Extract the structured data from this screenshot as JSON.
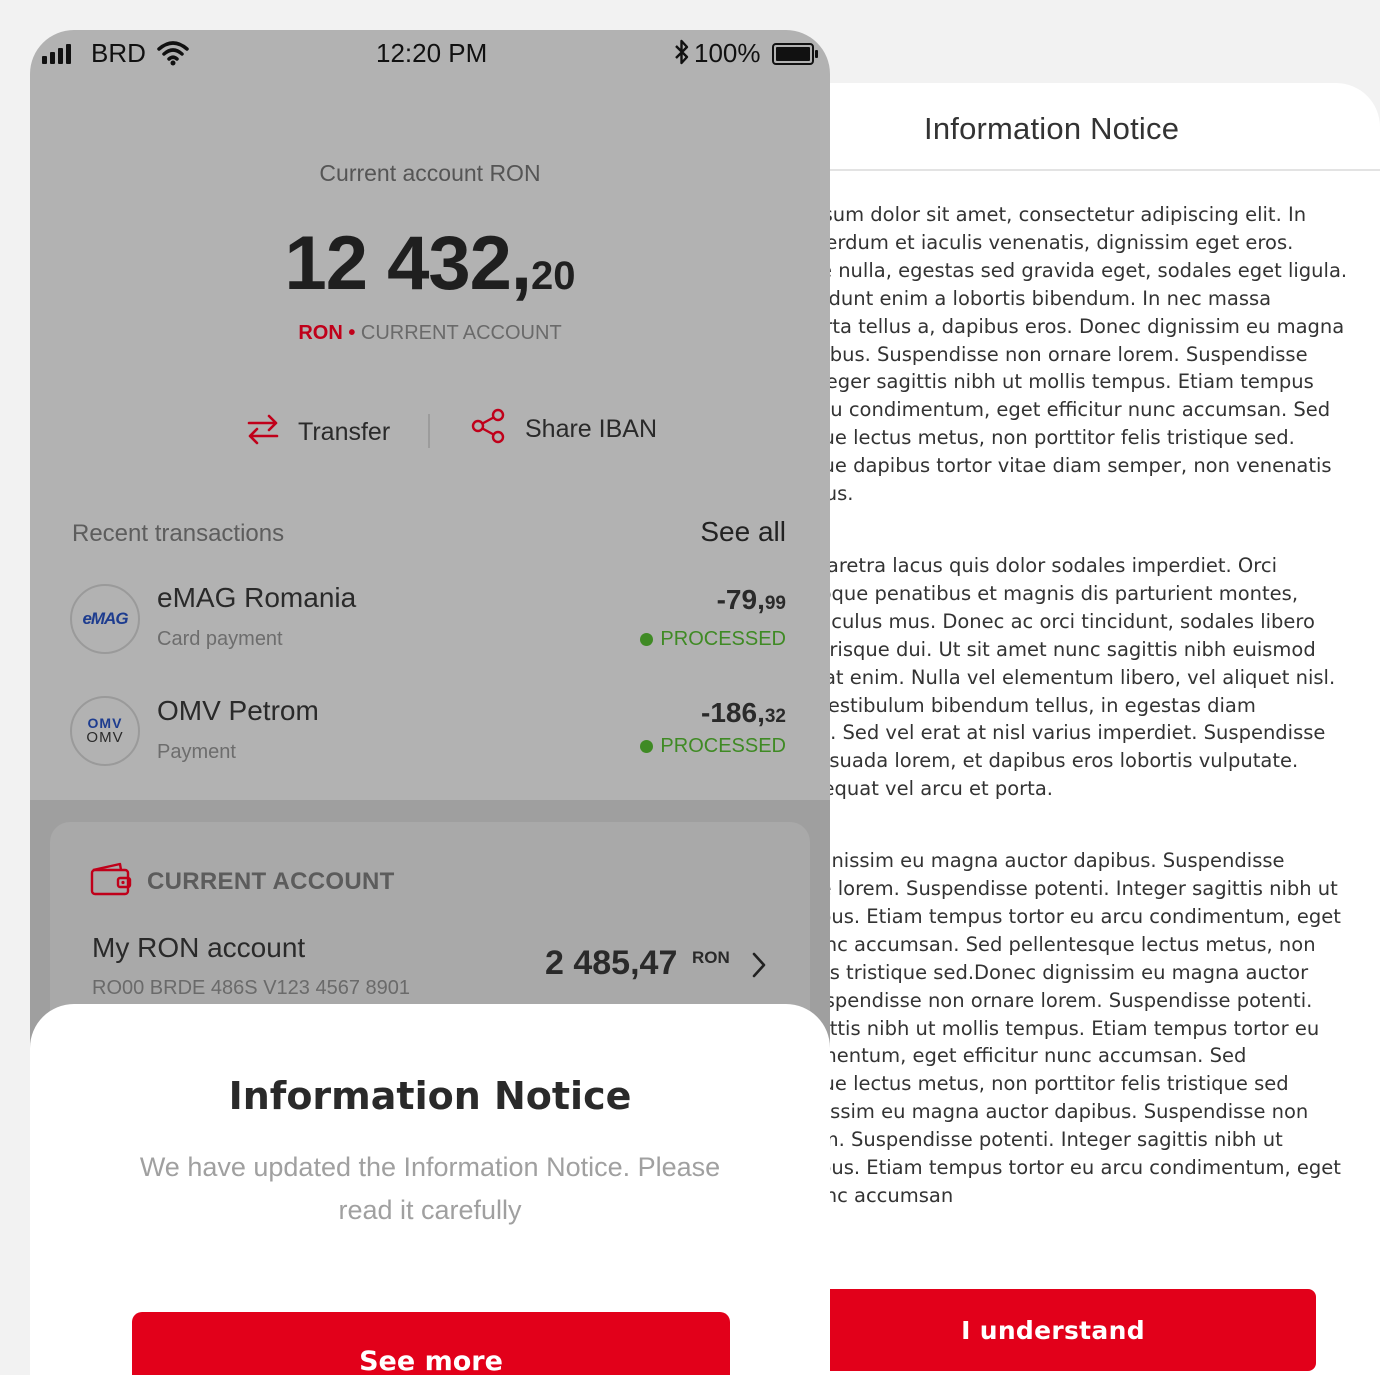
{
  "status_bar": {
    "carrier": "BRD",
    "time": "12:20 PM",
    "battery": "100%"
  },
  "account": {
    "label": "Current account RON",
    "balance_int": "12 432,",
    "balance_dec": "20",
    "currency": "RON",
    "separator": "•",
    "type": "CURRENT ACCOUNT"
  },
  "actions": {
    "transfer": "Transfer",
    "share_iban": "Share IBAN"
  },
  "recent": {
    "title": "Recent transactions",
    "see_all": "See all",
    "transactions": [
      {
        "name": "eMAG Romania",
        "type": "Card payment",
        "amount_int": "-79,",
        "amount_dec": "99",
        "status": "PROCESSED",
        "logo_text": "eMAG"
      },
      {
        "name": "OMV Petrom",
        "type": "Payment",
        "amount_int": "-186,",
        "amount_dec": "32",
        "status": "PROCESSED",
        "logo_text_top": "OMV",
        "logo_text_bottom": "OMV"
      }
    ]
  },
  "account_card": {
    "type": "CURRENT ACCOUNT",
    "name": "My RON account",
    "iban": "RO00 BRDE 486S V123 4567 8901",
    "balance": "2 485,47",
    "currency": "RON"
  },
  "sheet": {
    "title": "Information Notice",
    "text": "We have updated the Information Notice. Please read it carefully",
    "button": "See more"
  },
  "notice_page": {
    "title": "Information Notice",
    "paragraphs": [
      "rem ipsum dolor sit amet, consectetur adipiscing elit. In\n interdum et iaculis venenatis, dignissim eget eros.\nnte nulla, egestas sed gravida eget, sodales eget ligula.\nncidunt enim a lobortis bibendum. In nec massa\nporta tellus a, dapibus eros. Donec dignissim eu magna\napibus. Suspendisse non ornare lorem. Suspendisse\nInteger sagittis nibh ut mollis tempus. Etiam tempus\n arcu condimentum, eget efficitur nunc accumsan. Sed\nsque lectus metus, non porttitor felis tristique sed.\nsque dapibus tortor vitae diam semper, non venenatis\nnpus.",
      "uris pharetra lacus quis dolor sodales imperdiet. Orci\natoque penatibus et magnis dis parturient montes,\n ridiculus mus. Donec ac orci tincidunt, sodales libero\nelerisque dui. Ut sit amet nunc sagittis nibh euismod\nin at enim. Nulla vel elementum libero, vel aliquet nisl.\ns vestibulum bibendum tellus, in egestas diam\no a. Sed vel erat at nisl varius imperdiet. Suspendisse\nalesuada lorem, et dapibus eros lobortis vulputate.\nnsequat vel arcu et porta.",
      "nec dignissim eu magna auctor dapibus. Suspendisse\nare lorem. Suspendisse potenti. Integer sagittis nibh ut\nmpus. Etiam tempus tortor eu arcu condimentum, eget\nnunc accumsan. Sed pellentesque lectus metus, non\n felis tristique sed.Donec dignissim eu magna auctor\n Suspendisse non ornare lorem. Suspendisse potenti.\nagittis nibh ut mollis tempus. Etiam tempus tortor eu\ndimentum, eget efficitur nunc accumsan. Sed\nsque lectus metus, non porttitor felis tristique sed\ngnissim eu magna auctor dapibus. Suspendisse non\nrem. Suspendisse potenti. Integer sagittis nibh ut\nmpus. Etiam tempus tortor eu arcu condimentum, eget\nnunc accumsan"
    ],
    "button": "I understand"
  },
  "colors": {
    "brand_red": "#e2001a",
    "status_green": "#3f8a24"
  }
}
